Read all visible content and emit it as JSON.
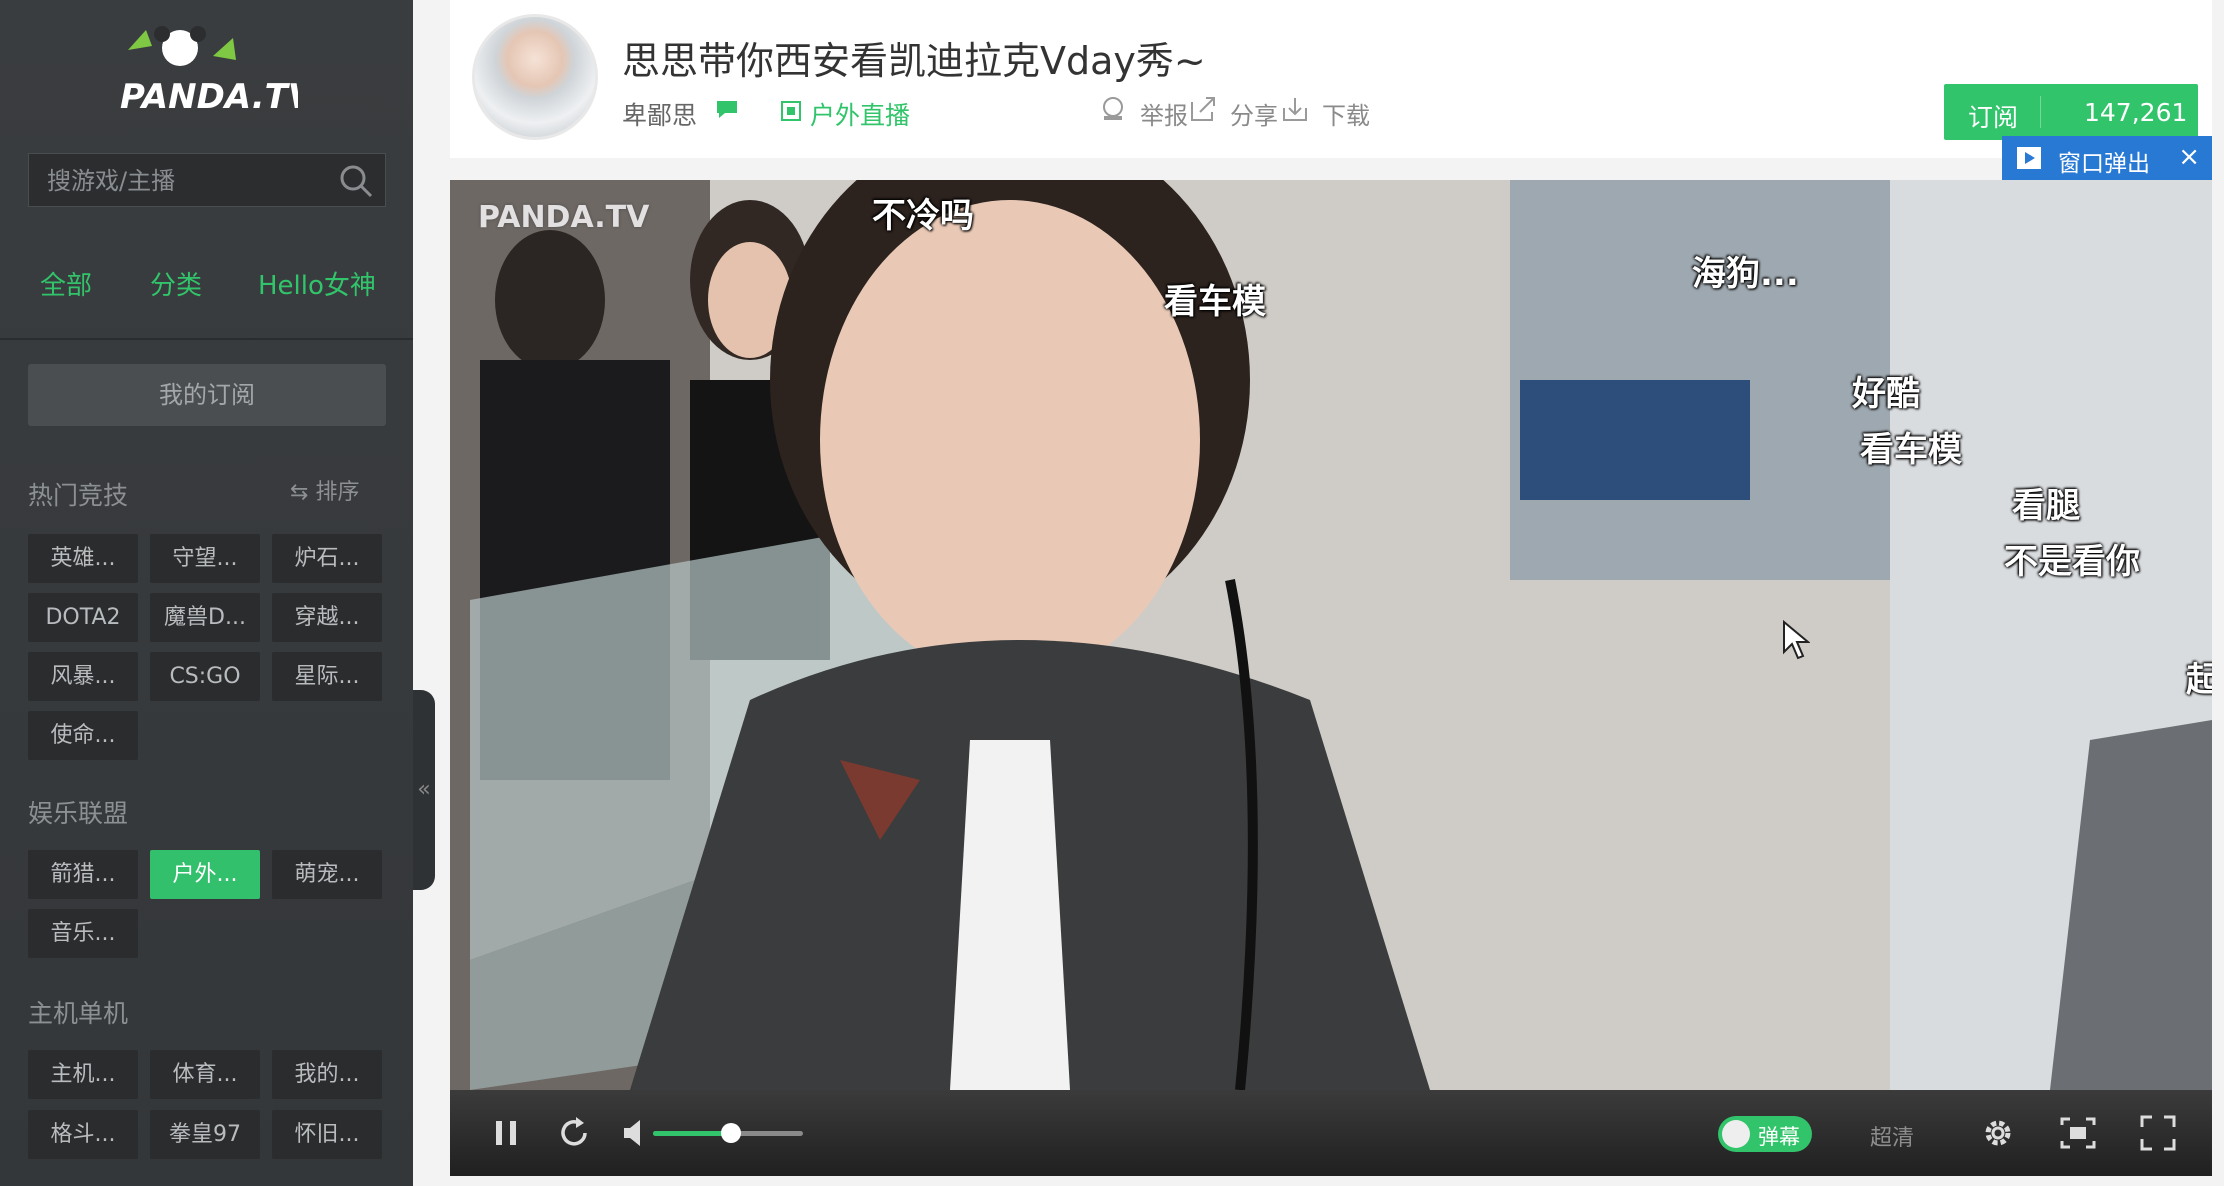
{
  "sidebar": {
    "logo_text": "PANDA.TV",
    "search": {
      "placeholder": "搜游戏/主播"
    },
    "topnav": [
      "全部",
      "分类",
      "Hello女神"
    ],
    "my_subscriptions": "我的订阅",
    "sort_label": "排序",
    "sections": [
      {
        "title": "热门竞技",
        "tags": [
          "英雄...",
          "守望...",
          "炉石...",
          "DOTA2",
          "魔兽D...",
          "穿越...",
          "风暴...",
          "CS:GO",
          "星际...",
          "使命..."
        ]
      },
      {
        "title": "娱乐联盟",
        "tags": [
          "箭猎...",
          "户外...",
          "萌宠...",
          "音乐..."
        ],
        "active": "户外..."
      },
      {
        "title": "主机单机",
        "tags": [
          "主机...",
          "体育...",
          "我的...",
          "格斗...",
          "拳皇97",
          "怀旧..."
        ]
      }
    ],
    "accent": "#31c46a"
  },
  "header": {
    "title": "思思带你西安看凯迪拉克Vday秀~",
    "streamer": "卑鄙思",
    "category": "户外直播",
    "actions": [
      "举报",
      "分享",
      "下载"
    ],
    "subscribe_label": "订阅",
    "subscriber_count": "147,261"
  },
  "player": {
    "watermark": "PANDA.TV",
    "popout_label": "窗口弹出",
    "danmu": [
      "不冷吗",
      "看车模",
      "海狗...",
      "好酷",
      "看车模",
      "看腿",
      "不是看你",
      "起"
    ],
    "volume_level": 0.52,
    "danmu_toggle_label": "弹幕",
    "quality_label": "超清"
  }
}
